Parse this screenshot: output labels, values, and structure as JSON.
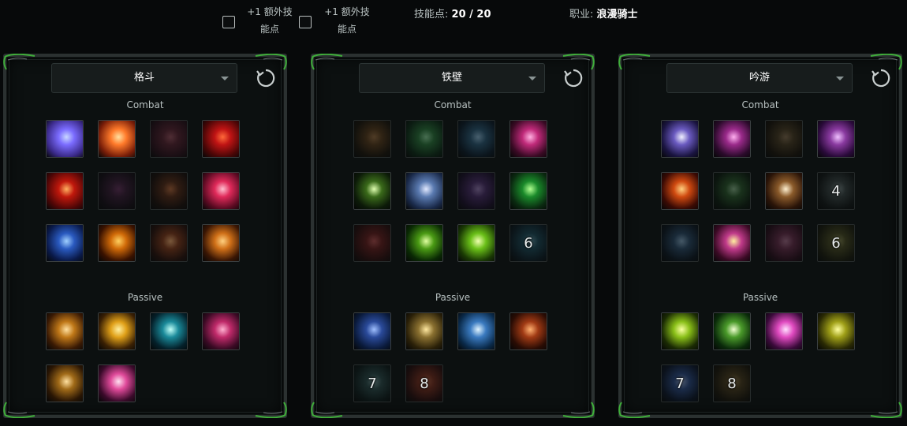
{
  "top": {
    "extra_point_1": "+1 额外技\n能点",
    "extra_point_2": "+1 额外技\n能点",
    "skill_points_label": "技能点:",
    "skill_points_value": "20 / 20",
    "class_label": "职业:",
    "class_value": "浪漫骑士"
  },
  "panels": [
    {
      "tree": "格斗",
      "combat_label": "Combat",
      "passive_label": "Passive",
      "combat": [
        {
          "icon": "dash-slash-icon",
          "colors": [
            "#3b2a8a",
            "#7b6cff",
            "#c8d8ff"
          ],
          "dim": false,
          "rank": ""
        },
        {
          "icon": "thrown-dagger-icon",
          "colors": [
            "#7a1e08",
            "#ff7a2a",
            "#ffe0a0"
          ],
          "dim": false,
          "rank": ""
        },
        {
          "icon": "shadow-strike-icon",
          "colors": [
            "#2a0c18",
            "#5c2030",
            "#a05060"
          ],
          "dim": true,
          "rank": ""
        },
        {
          "icon": "vortex-icon",
          "colors": [
            "#4a0606",
            "#c01414",
            "#ff6a3a"
          ],
          "dim": false,
          "rank": ""
        },
        {
          "icon": "blade-burst-icon",
          "colors": [
            "#500606",
            "#c0180c",
            "#ffb060"
          ],
          "dim": false,
          "rank": ""
        },
        {
          "icon": "dark-veil-icon",
          "colors": [
            "#140a14",
            "#3a1a36",
            "#6a3060"
          ],
          "dim": true,
          "rank": ""
        },
        {
          "icon": "spear-thrust-icon",
          "colors": [
            "#1a0c08",
            "#5a2a14",
            "#c06a3a"
          ],
          "dim": true,
          "rank": ""
        },
        {
          "icon": "heart-burst-icon",
          "colors": [
            "#5a0a22",
            "#e02a5a",
            "#ffc0d0"
          ],
          "dim": false,
          "rank": ""
        },
        {
          "icon": "lightning-blade-icon",
          "colors": [
            "#0a1a4a",
            "#2a5ac0",
            "#a0d0ff"
          ],
          "dim": false,
          "rank": ""
        },
        {
          "icon": "fire-aura-icon",
          "colors": [
            "#3a1200",
            "#d06a08",
            "#ffd060"
          ],
          "dim": false,
          "rank": ""
        },
        {
          "icon": "hammer-smash-icon",
          "colors": [
            "#2a0e08",
            "#8a3a18",
            "#ffb070"
          ],
          "dim": true,
          "rank": ""
        },
        {
          "icon": "warrior-leap-icon",
          "colors": [
            "#3a1604",
            "#d07018",
            "#ffd080"
          ],
          "dim": false,
          "rank": ""
        }
      ],
      "passive": [
        {
          "icon": "spear-stance-icon",
          "colors": [
            "#3a1a04",
            "#c07818",
            "#ffe0a0"
          ],
          "dim": false,
          "rank": ""
        },
        {
          "icon": "golden-spin-icon",
          "colors": [
            "#3a2004",
            "#e0a018",
            "#fff0a0"
          ],
          "dim": false,
          "rank": ""
        },
        {
          "icon": "piercing-star-icon",
          "colors": [
            "#04202a",
            "#1a8a9a",
            "#c0fff8"
          ],
          "dim": false,
          "rank": ""
        },
        {
          "icon": "pink-fist-icon",
          "colors": [
            "#3a0a24",
            "#c02a6a",
            "#ffb0d0"
          ],
          "dim": false,
          "rank": ""
        },
        {
          "icon": "twin-axes-icon",
          "colors": [
            "#2a1604",
            "#a06a18",
            "#ffe0a0"
          ],
          "dim": false,
          "rank": ""
        },
        {
          "icon": "holy-blades-icon",
          "colors": [
            "#3a0a2a",
            "#e04a9a",
            "#ffe0f0"
          ],
          "dim": false,
          "rank": ""
        }
      ]
    },
    {
      "tree": "铁壁",
      "combat_label": "Combat",
      "passive_label": "Passive",
      "combat": [
        {
          "icon": "shield-bash-icon",
          "colors": [
            "#1a1208",
            "#5a3a18",
            "#a07040"
          ],
          "dim": true,
          "rank": ""
        },
        {
          "icon": "ground-fist-icon",
          "colors": [
            "#0a2a14",
            "#2a7a3a",
            "#90e0a0"
          ],
          "dim": true,
          "rank": ""
        },
        {
          "icon": "shadow-grab-icon",
          "colors": [
            "#0a1a2a",
            "#2a5a7a",
            "#90c0e0"
          ],
          "dim": true,
          "rank": ""
        },
        {
          "icon": "demon-helm-icon",
          "colors": [
            "#3a0a24",
            "#c02a7a",
            "#ffb0e0"
          ],
          "dim": false,
          "rank": ""
        },
        {
          "icon": "whip-lash-icon",
          "colors": [
            "#0c1a08",
            "#3a6a1a",
            "#e0ffb0"
          ],
          "dim": false,
          "rank": ""
        },
        {
          "icon": "round-shield-icon",
          "colors": [
            "#1a2a4a",
            "#5a7ab0",
            "#e0e8ff"
          ],
          "dim": false,
          "rank": ""
        },
        {
          "icon": "stand-firm-icon",
          "colors": [
            "#1a0c2a",
            "#4a2a6a",
            "#a080c0"
          ],
          "dim": true,
          "rank": ""
        },
        {
          "icon": "uplift-arrow-icon",
          "colors": [
            "#0a2a10",
            "#1a8a2a",
            "#b0ff90"
          ],
          "dim": false,
          "rank": ""
        },
        {
          "icon": "mirror-shield-icon",
          "colors": [
            "#2a0a0a",
            "#6a1a1a",
            "#c05050"
          ],
          "dim": true,
          "rank": ""
        },
        {
          "icon": "silhouette-icon",
          "colors": [
            "#0a2a04",
            "#4a9a14",
            "#e0ffa0"
          ],
          "dim": false,
          "rank": ""
        },
        {
          "icon": "cube-guard-icon",
          "colors": [
            "#1a3a04",
            "#6ac018",
            "#f0ffb0"
          ],
          "dim": false,
          "rank": ""
        },
        {
          "icon": "iron-body-icon",
          "colors": [
            "#0a1a24",
            "#1a4a5a",
            "#6aa0b0"
          ],
          "dim": true,
          "rank": "6"
        }
      ],
      "passive": [
        {
          "icon": "kite-shield-icon",
          "colors": [
            "#0a1a3a",
            "#2a4a9a",
            "#a0c0ff"
          ],
          "dim": false,
          "rank": ""
        },
        {
          "icon": "treasure-chest-icon",
          "colors": [
            "#2a2008",
            "#8a7030",
            "#ffe8a0"
          ],
          "dim": false,
          "rank": ""
        },
        {
          "icon": "light-shield-icon",
          "colors": [
            "#0a2a4a",
            "#3a7ac0",
            "#e0f4ff"
          ],
          "dim": false,
          "rank": ""
        },
        {
          "icon": "guardian-figure-icon",
          "colors": [
            "#2a0c04",
            "#a03a14",
            "#ffb070"
          ],
          "dim": false,
          "rank": ""
        },
        {
          "icon": "bear-claw-icon",
          "colors": [
            "#0c1a1a",
            "#2a4a4a",
            "#7aa0a0"
          ],
          "dim": true,
          "rank": "7"
        },
        {
          "icon": "banner-icon",
          "colors": [
            "#2a0a0a",
            "#7a2a1a",
            "#c06040"
          ],
          "dim": true,
          "rank": "8"
        }
      ]
    },
    {
      "tree": "吟游",
      "combat_label": "Combat",
      "passive_label": "Passive",
      "combat": [
        {
          "icon": "magnet-song-icon",
          "colors": [
            "#1a1440",
            "#6a5ac0",
            "#f0f0ff"
          ],
          "dim": false,
          "rank": ""
        },
        {
          "icon": "music-notes-icon",
          "colors": [
            "#2a0a2a",
            "#9a2a8a",
            "#ffb0f0"
          ],
          "dim": false,
          "rank": ""
        },
        {
          "icon": "treble-clef-icon",
          "colors": [
            "#1a1208",
            "#4a3a20",
            "#8a7050"
          ],
          "dim": true,
          "rank": ""
        },
        {
          "icon": "screaming-face-icon",
          "colors": [
            "#2a0a3a",
            "#8a3aa0",
            "#f0c0ff"
          ],
          "dim": false,
          "rank": ""
        },
        {
          "icon": "flame-horn-icon",
          "colors": [
            "#3a0a04",
            "#d04a10",
            "#ffd080"
          ],
          "dim": false,
          "rank": ""
        },
        {
          "icon": "green-melody-icon",
          "colors": [
            "#0a1a0c",
            "#2a5a2a",
            "#90c090"
          ],
          "dim": true,
          "rank": ""
        },
        {
          "icon": "eighth-note-icon",
          "colors": [
            "#2a1408",
            "#8a5a2a",
            "#fff0d0"
          ],
          "dim": false,
          "rank": ""
        },
        {
          "icon": "silver-clef-icon",
          "colors": [
            "#101414",
            "#3a4444",
            "#8a9a9a"
          ],
          "dim": true,
          "rank": "4"
        },
        {
          "icon": "lyre-icon",
          "colors": [
            "#0a1420",
            "#2a4a6a",
            "#8ab0d0"
          ],
          "dim": true,
          "rank": ""
        },
        {
          "icon": "golden-trumpet-icon",
          "colors": [
            "#3a0a24",
            "#c03a8a",
            "#fff0a0"
          ],
          "dim": false,
          "rank": ""
        },
        {
          "icon": "crossed-swords-icon",
          "colors": [
            "#2a0a1a",
            "#6a2a4a",
            "#b07090"
          ],
          "dim": true,
          "rank": ""
        },
        {
          "icon": "bard-portrait-icon",
          "colors": [
            "#1a1a0a",
            "#4a4a20",
            "#a0a060"
          ],
          "dim": true,
          "rank": "6"
        }
      ],
      "passive": [
        {
          "icon": "green-strings-icon",
          "colors": [
            "#1a2a04",
            "#8ac018",
            "#f8ffa0"
          ],
          "dim": false,
          "rank": ""
        },
        {
          "icon": "hourglass-icon",
          "colors": [
            "#0a2a0a",
            "#4a9a2a",
            "#f0ffd0"
          ],
          "dim": false,
          "rank": ""
        },
        {
          "icon": "pink-comet-icon",
          "colors": [
            "#3a0a3a",
            "#e04ac0",
            "#ffe0ff"
          ],
          "dim": false,
          "rank": ""
        },
        {
          "icon": "golden-harp-icon",
          "colors": [
            "#2a2a04",
            "#a0a018",
            "#ffffa0"
          ],
          "dim": false,
          "rank": ""
        },
        {
          "icon": "open-hand-icon",
          "colors": [
            "#0a142a",
            "#2a4a8a",
            "#9ab0e0"
          ],
          "dim": true,
          "rank": "7"
        },
        {
          "icon": "drum-icon",
          "colors": [
            "#1a1408",
            "#4a3a1a",
            "#9a8050"
          ],
          "dim": true,
          "rank": "8"
        }
      ]
    }
  ]
}
